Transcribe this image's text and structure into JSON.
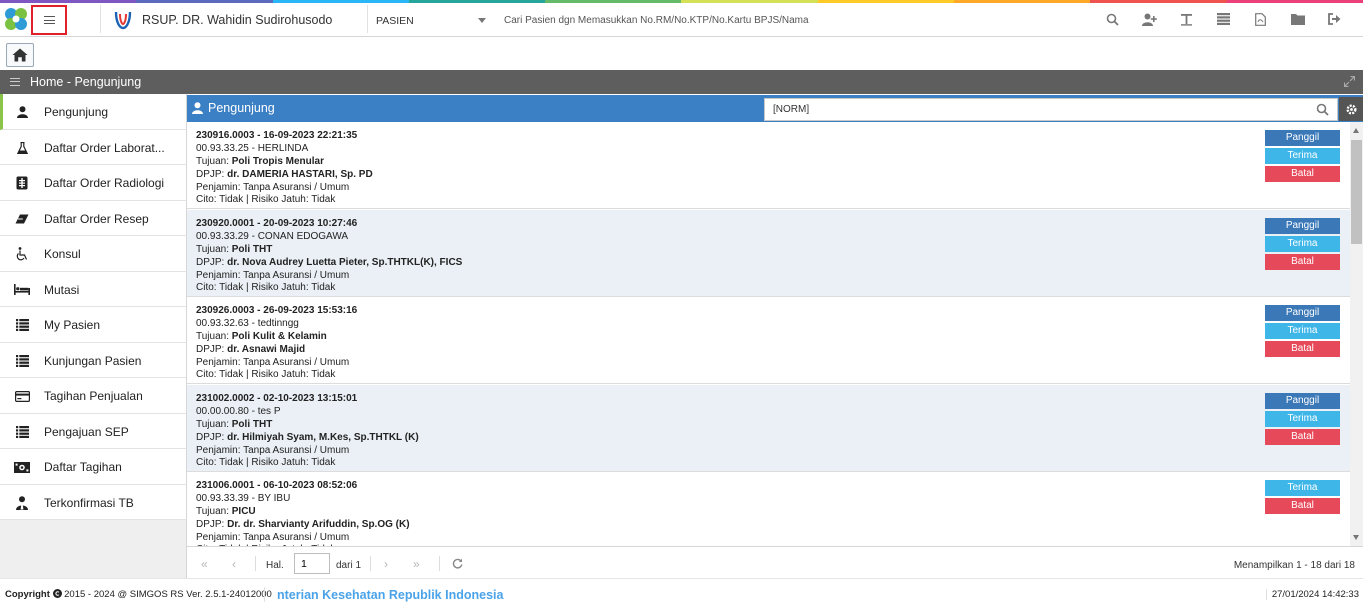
{
  "topbar": {
    "hospital_name": "RSUP. DR. Wahidin Sudirohusodo",
    "category_select": "PASIEN",
    "search_hint": "Cari Pasien dgn Memasukkan No.RM/No.KTP/No.Kartu BPJS/Nama",
    "icons": [
      "search-icon",
      "user-plus-icon",
      "text-icon",
      "list-icon",
      "pdf-file-icon",
      "folder-icon",
      "logout-icon"
    ],
    "rainbow_colors": [
      "#7e57c2",
      "#5c6bc0",
      "#29b6f6",
      "#26a69a",
      "#66bb6a",
      "#d4e157",
      "#ffca28",
      "#ffa726",
      "#ef5350",
      "#ec407a"
    ]
  },
  "breadcrumb": {
    "title": "Home - Pengunjung"
  },
  "sidebar": {
    "items": [
      {
        "label": "Pengunjung",
        "icon": "user-icon"
      },
      {
        "label": "Daftar Order Laborat...",
        "icon": "flask-icon"
      },
      {
        "label": "Daftar Order Radiologi",
        "icon": "xray-icon"
      },
      {
        "label": "Daftar Order Resep",
        "icon": "eraser-icon"
      },
      {
        "label": "Konsul",
        "icon": "wheelchair-icon"
      },
      {
        "label": "Mutasi",
        "icon": "bed-icon"
      },
      {
        "label": "My Pasien",
        "icon": "list-icon"
      },
      {
        "label": "Kunjungan Pasien",
        "icon": "list-icon"
      },
      {
        "label": "Tagihan Penjualan",
        "icon": "credit-card-icon"
      },
      {
        "label": "Pengajuan SEP",
        "icon": "list-icon"
      },
      {
        "label": "Daftar Tagihan",
        "icon": "money-icon"
      },
      {
        "label": "Terkonfirmasi TB",
        "icon": "user-tie-icon"
      }
    ]
  },
  "panel": {
    "title": "Pengunjung",
    "filter_value": "[NORM]"
  },
  "list_labels": {
    "tujuan": "Tujuan: ",
    "dpjp": "DPJP: ",
    "panggil": "Panggil",
    "terima": "Terima",
    "batal": "Batal"
  },
  "visits": [
    {
      "header": "230916.0003 - 16-09-2023 22:21:35",
      "patient": "00.93.33.25 - HERLINDA",
      "tujuan": "Poli Tropis Menular",
      "dpjp": "dr. DAMERIA HASTARI, Sp. PD",
      "penjamin": "Penjamin: Tanpa Asuransi / Umum",
      "cito": "Cito: Tidak | Risiko Jatuh: Tidak"
    },
    {
      "header": "230920.0001 - 20-09-2023 10:27:46",
      "patient": "00.93.33.29 - CONAN EDOGAWA",
      "tujuan": "Poli THT",
      "dpjp": "dr. Nova Audrey Luetta Pieter, Sp.THTKL(K), FICS",
      "penjamin": "Penjamin: Tanpa Asuransi / Umum",
      "cito": "Cito: Tidak | Risiko Jatuh: Tidak"
    },
    {
      "header": "230926.0003 - 26-09-2023 15:53:16",
      "patient": "00.93.32.63 - tedtinngg",
      "tujuan": "Poli Kulit & Kelamin",
      "dpjp": "dr. Asnawi Majid",
      "penjamin": "Penjamin: Tanpa Asuransi / Umum",
      "cito": "Cito: Tidak | Risiko Jatuh: Tidak"
    },
    {
      "header": "231002.0002 - 02-10-2023 13:15:01",
      "patient": "00.00.00.80 - tes P",
      "tujuan": "Poli THT",
      "dpjp": "dr. Hilmiyah Syam, M.Kes, Sp.THTKL (K)",
      "penjamin": "Penjamin: Tanpa Asuransi / Umum",
      "cito": "Cito: Tidak | Risiko Jatuh: Tidak"
    },
    {
      "header": "231006.0001 - 06-10-2023 08:52:06",
      "patient": "00.93.33.39 - BY IBU",
      "tujuan": "PICU",
      "dpjp": "Dr. dr. Sharvianty Arifuddin, Sp.OG (K)",
      "penjamin": "Penjamin: Tanpa Asuransi / Umum",
      "cito": "Cito: Tidak | Risiko Jatuh: Tidak"
    }
  ],
  "pager": {
    "hal_label": "Hal.",
    "page": "1",
    "of_label": "dari 1",
    "status": "Menampilkan 1 - 18 dari 18"
  },
  "footer": {
    "copyright_label": "Copyright",
    "copyright_rest": "2015 - 2024 @ SIMGOS RS Ver. 2.5.1-24012000",
    "marquee": "nterian Kesehatan Republik Indonesia",
    "datetime": "27/01/2024 14:42:33"
  }
}
